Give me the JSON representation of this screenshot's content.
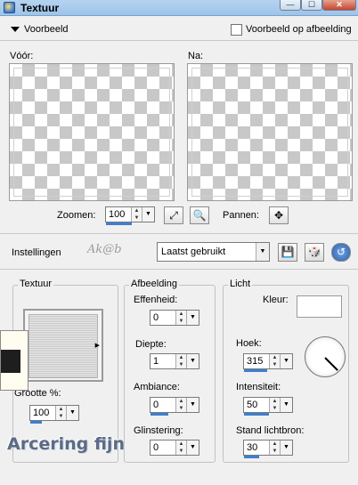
{
  "window": {
    "title": "Textuur",
    "min_glyph": "—",
    "max_glyph": "☐",
    "close_glyph": "✕"
  },
  "preview": {
    "label": "Voorbeeld",
    "show_on_image_label": "Voorbeeld op afbeelding",
    "show_on_image_checked": false,
    "before_label": "Vóór:",
    "after_label": "Na:"
  },
  "zoom": {
    "label": "Zoomen:",
    "value": "100",
    "pan_label": "Pannen:"
  },
  "settings": {
    "label": "Instellingen",
    "logo_text": "Ak@b",
    "preset_value": "Laatst gebruikt"
  },
  "texture_group": {
    "title": "Textuur",
    "size_label": "Grootte %:",
    "size_value": "100"
  },
  "image_group": {
    "title": "Afbeelding",
    "smoothness_label": "Effenheid:",
    "smoothness_value": "0",
    "depth_label": "Diepte:",
    "depth_value": "1",
    "ambiance_label": "Ambiance:",
    "ambiance_value": "0",
    "shine_label": "Glinstering:",
    "shine_value": "0"
  },
  "light_group": {
    "title": "Licht",
    "color_label": "Kleur:",
    "color": "#ffffff",
    "angle_label": "Hoek:",
    "angle_value": "315",
    "intensity_label": "Intensiteit:",
    "intensity_value": "50",
    "elevation_label": "Stand lichtbron:",
    "elevation_value": "30"
  },
  "watermark": "Arcering fijn",
  "colors": {
    "slider_fill": "#3c7fd1",
    "title_bar": "#b5d3f0"
  }
}
